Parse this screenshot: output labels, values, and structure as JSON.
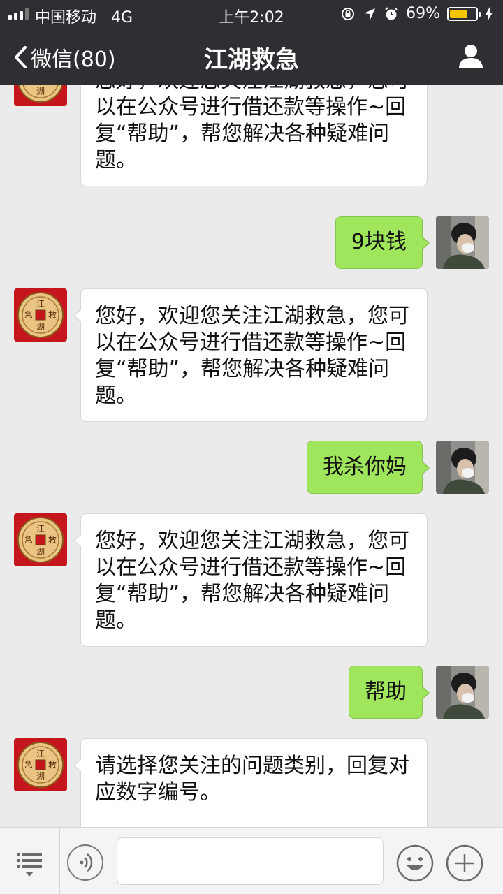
{
  "status_bar": {
    "carrier": "中国移动",
    "network": "4G",
    "time": "上午2:02",
    "battery_percent": "69%",
    "battery_level": 0.69
  },
  "nav": {
    "back_label": "微信(80)",
    "title": "江湖救急"
  },
  "bot_avatar": {
    "chars": [
      "江",
      "救",
      "急",
      "湖"
    ]
  },
  "messages": [
    {
      "from": "bot",
      "text": "您好，欢迎您关注江湖救急，您可以在公众号进行借还款等操作~回复“帮助”，帮您解决各种疑难问题。"
    },
    {
      "from": "me",
      "text": "9块钱"
    },
    {
      "from": "bot",
      "text": "您好，欢迎您关注江湖救急，您可以在公众号进行借还款等操作~回复“帮助”，帮您解决各种疑难问题。"
    },
    {
      "from": "me",
      "text": "我杀你妈"
    },
    {
      "from": "bot",
      "text": "您好，欢迎您关注江湖救急，您可以在公众号进行借还款等操作~回复“帮助”，帮您解决各种疑难问题。"
    },
    {
      "from": "me",
      "text": "帮助"
    },
    {
      "from": "bot",
      "text": "请选择您关注的问题类别，回复对应数字编号。"
    }
  ],
  "input_bar": {
    "text_value": ""
  },
  "icons": {
    "menu": "menu-list-icon",
    "voice": "voice-icon",
    "emoji": "emoji-icon",
    "plus": "plus-icon",
    "back": "chevron-left-icon",
    "profile": "person-icon"
  },
  "colors": {
    "nav_bg": "#2e2e33",
    "chat_bg": "#ebebeb",
    "bubble_out": "#9fe65c",
    "bubble_in": "#ffffff",
    "battery": "#f5c400",
    "bot_avatar_bg": "#c4161c"
  }
}
